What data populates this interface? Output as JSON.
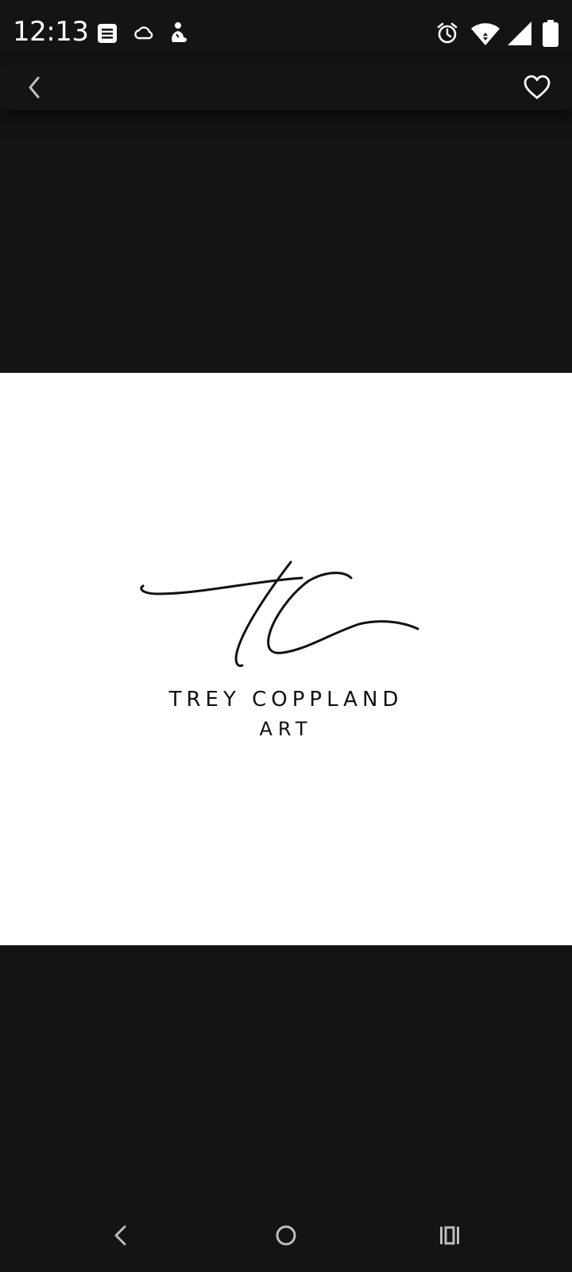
{
  "status_bar": {
    "time": "12:13",
    "left_icons": [
      "notes-icon",
      "cloud-icon",
      "person-icon"
    ],
    "right_icons": [
      "alarm-icon",
      "wifi-icon",
      "signal-icon",
      "battery-icon"
    ]
  },
  "app_bar": {
    "back_icon": "chevron-left-icon",
    "favorite_icon": "heart-outline-icon"
  },
  "image": {
    "logo_monogram": "tc",
    "brand_line1": "TREY COPPLAND",
    "brand_line2": "ART",
    "background_color": "#ffffff"
  },
  "nav_bar": {
    "buttons": [
      "nav-back-icon",
      "nav-home-icon",
      "nav-recents-icon"
    ]
  },
  "colors": {
    "background": "#141414",
    "icon": "#ffffff",
    "nav_icon": "#bdbdbd"
  }
}
